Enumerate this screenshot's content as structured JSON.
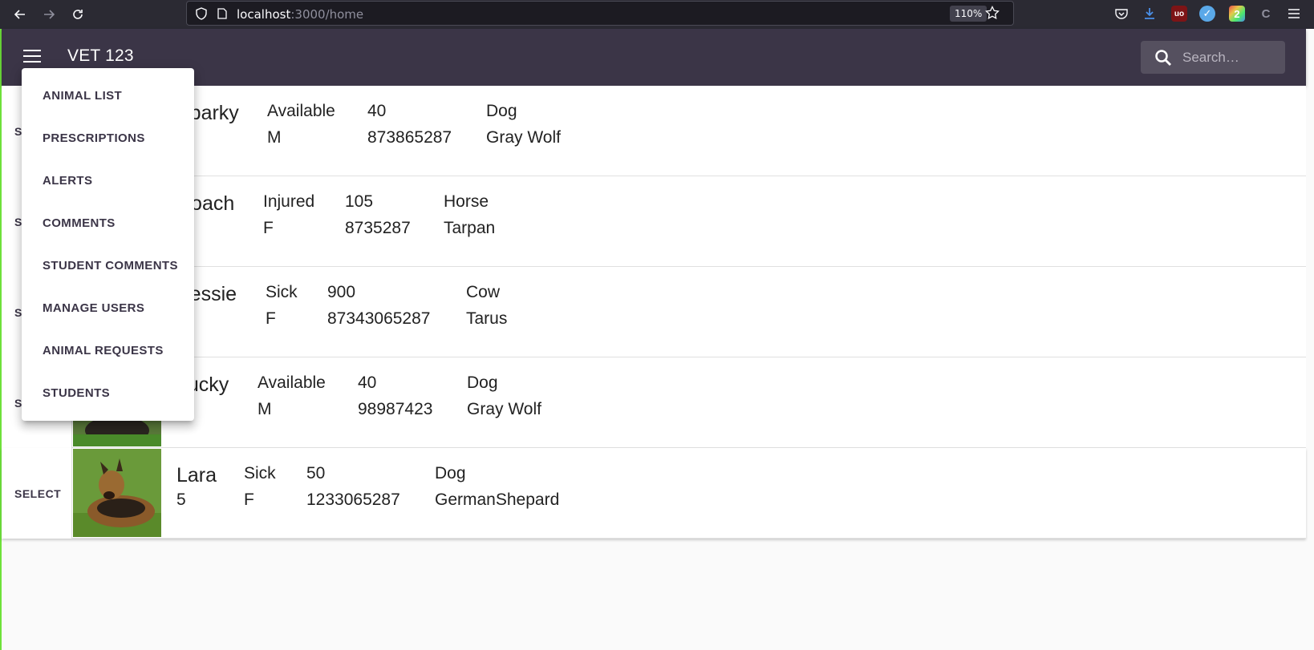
{
  "browser": {
    "url_host": "localhost",
    "url_path": ":3000/home",
    "zoom": "110%"
  },
  "app": {
    "title": "VET 123",
    "search_placeholder": "Search…"
  },
  "menu": {
    "items": [
      {
        "label": "ANIMAL LIST"
      },
      {
        "label": "PRESCRIPTIONS"
      },
      {
        "label": "ALERTS"
      },
      {
        "label": "COMMENTS"
      },
      {
        "label": "STUDENT COMMENTS"
      },
      {
        "label": "MANAGE USERS"
      },
      {
        "label": "ANIMAL REQUESTS"
      },
      {
        "label": "STUDENTS"
      }
    ]
  },
  "animals": [
    {
      "select": "SELECT",
      "name": "Sparky",
      "age": "",
      "status": "Available",
      "sex": "M",
      "weight": "40",
      "tattoo": "873865287",
      "species": "Dog",
      "breed": "Gray Wolf"
    },
    {
      "select": "SELECT",
      "name": "Roach",
      "age": "",
      "status": "Injured",
      "sex": "F",
      "weight": "105",
      "tattoo": "8735287",
      "species": "Horse",
      "breed": "Tarpan"
    },
    {
      "select": "SELECT",
      "name": "Bessie",
      "age": "",
      "status": "Sick",
      "sex": "F",
      "weight": "900",
      "tattoo": "87343065287",
      "species": "Cow",
      "breed": "Tarus"
    },
    {
      "select": "SELECT",
      "name": "Lucky",
      "age": "",
      "status": "Available",
      "sex": "M",
      "weight": "40",
      "tattoo": "98987423",
      "species": "Dog",
      "breed": "Gray Wolf"
    },
    {
      "select": "SELECT",
      "name": "Lara",
      "age": "5",
      "status": "Sick",
      "sex": "F",
      "weight": "50",
      "tattoo": "1233065287",
      "species": "Dog",
      "breed": "GermanShepard"
    }
  ],
  "colors": {
    "app_bar": "#3b3547",
    "accent_green": "#6ee13a"
  }
}
